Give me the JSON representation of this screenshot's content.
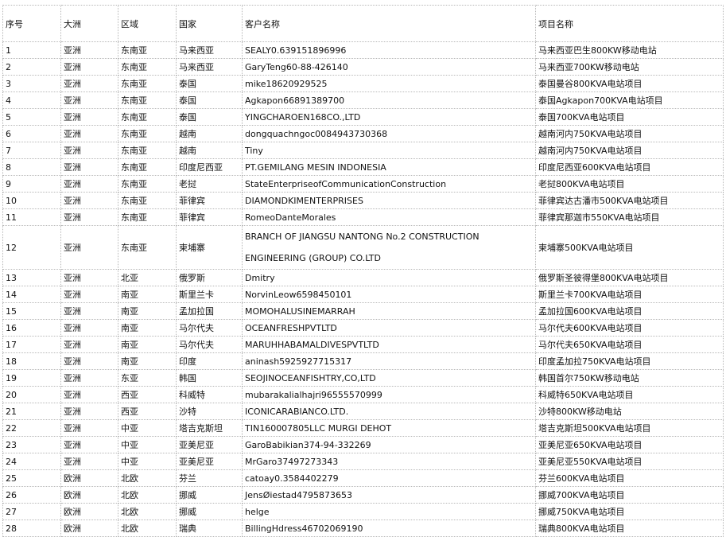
{
  "table": {
    "headers": [
      "序号",
      "大洲",
      "区域",
      "国家",
      "客户名称",
      "项目名称"
    ],
    "rows": [
      [
        "1",
        "亚洲",
        "东南亚",
        "马来西亚",
        "SEALY0.639151896996",
        "马来西亚巴生800KW移动电站"
      ],
      [
        "2",
        "亚洲",
        "东南亚",
        "马来西亚",
        "GaryTeng60-88-426140",
        "马来西亚700KW移动电站"
      ],
      [
        "3",
        "亚洲",
        "东南亚",
        "泰国",
        "mike18620929525",
        "泰国曼谷800KVA电站项目"
      ],
      [
        "4",
        "亚洲",
        "东南亚",
        "泰国",
        "Agkapon66891389700",
        "泰国Agkapon700KVA电站项目"
      ],
      [
        "5",
        "亚洲",
        "东南亚",
        "泰国",
        "YINGCHAROEN168CO.,LTD",
        "泰国700KVA电站项目"
      ],
      [
        "6",
        "亚洲",
        "东南亚",
        "越南",
        "dongquachngoc0084943730368",
        "越南河内750KVA电站项目"
      ],
      [
        "7",
        "亚洲",
        "东南亚",
        "越南",
        "Tiny",
        "越南河内750KVA电站项目"
      ],
      [
        "8",
        "亚洲",
        "东南亚",
        "印度尼西亚",
        "PT.GEMILANG MESIN INDONESIA",
        "印度尼西亚600KVA电站项目"
      ],
      [
        "9",
        "亚洲",
        "东南亚",
        "老挝",
        "StateEnterpriseofCommunicationConstruction",
        "老挝800KVA电站项目"
      ],
      [
        "10",
        "亚洲",
        "东南亚",
        "菲律宾",
        "DIAMONDKIMENTERPRISES",
        "菲律宾达古潘市500KVA电站项目"
      ],
      [
        "11",
        "亚洲",
        "东南亚",
        "菲律宾",
        "RomeoDanteMorales",
        "菲律宾那迦市550KVA电站项目"
      ],
      [
        "12",
        "亚洲",
        "东南亚",
        "柬埔寨",
        "BRANCH OF JIANGSU NANTONG No.2 CONSTRUCTION ENGINEERING (GROUP) CO.LTD",
        "柬埔寨500KVA电站项目"
      ],
      [
        "13",
        "亚洲",
        "北亚",
        "俄罗斯",
        "Dmitry",
        "俄罗斯圣彼得堡800KVA电站项目"
      ],
      [
        "14",
        "亚洲",
        "南亚",
        "斯里兰卡",
        "NorvinLeow6598450101",
        "斯里兰卡700KVA电站项目"
      ],
      [
        "15",
        "亚洲",
        "南亚",
        "孟加拉国",
        "MOMOHALUSINEMARRAH",
        "孟加拉国600KVA电站项目"
      ],
      [
        "16",
        "亚洲",
        "南亚",
        "马尔代夫",
        "OCEANFRESHPVTLTD",
        "马尔代夫600KVA电站项目"
      ],
      [
        "17",
        "亚洲",
        "南亚",
        "马尔代夫",
        "MARUHHABAMALDIVESPVTLTD",
        "马尔代夫650KVA电站项目"
      ],
      [
        "18",
        "亚洲",
        "南亚",
        "印度",
        "aninash5925927715317",
        "印度孟加拉750KVA电站项目"
      ],
      [
        "19",
        "亚洲",
        "东亚",
        "韩国",
        "SEOJINOCEANFISHTRY,CO,LTD",
        "韩国首尔750KW移动电站"
      ],
      [
        "20",
        "亚洲",
        "西亚",
        "科威特",
        "mubarakalialhajri96555570999",
        "科威特650KVA电站项目"
      ],
      [
        "21",
        "亚洲",
        "西亚",
        "沙特",
        "ICONICARABIANCO.LTD.",
        "沙特800KW移动电站"
      ],
      [
        "22",
        "亚洲",
        "中亚",
        "塔吉克斯坦",
        "TIN160007805LLC MURGI DEHOT",
        "塔吉克斯坦500KVA电站项目"
      ],
      [
        "23",
        "亚洲",
        "中亚",
        "亚美尼亚",
        "GaroBabikian374-94-332269",
        "亚美尼亚650KVA电站项目"
      ],
      [
        "24",
        "亚洲",
        "中亚",
        "亚美尼亚",
        "MrGaro37497273343",
        "亚美尼亚550KVA电站项目"
      ],
      [
        "25",
        "欧洲",
        "北欧",
        "芬兰",
        "catoay0.3584402279",
        "芬兰600KVA电站项目"
      ],
      [
        "26",
        "欧洲",
        "北欧",
        "挪威",
        "JensØiestad4795873653",
        "挪威700KVA电站项目"
      ],
      [
        "27",
        "欧洲",
        "北欧",
        "挪威",
        "helge",
        "挪威750KVA电站项目"
      ],
      [
        "28",
        "欧洲",
        "北欧",
        "瑞典",
        "BillingHdress46702069190",
        "瑞典800KVA电站项目"
      ]
    ]
  }
}
